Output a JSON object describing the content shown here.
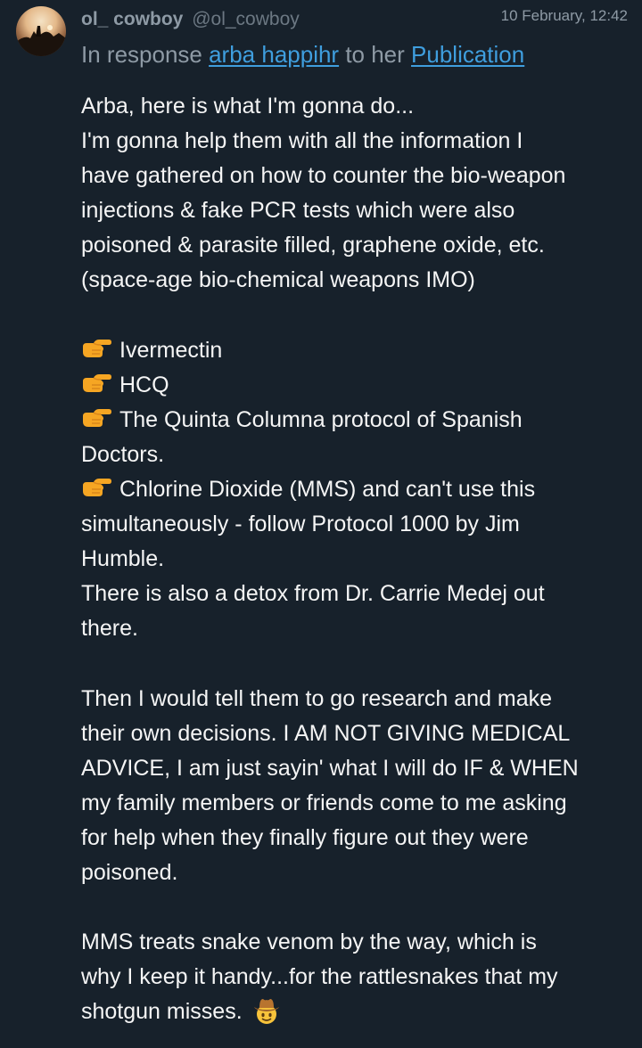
{
  "post": {
    "author_name": "ol_ cowboy",
    "author_handle": "@ol_cowboy",
    "timestamp": "10 February, 12:42",
    "reply": {
      "prefix": "In response ",
      "user_link": "arba happihr",
      "middle": " to her ",
      "publication_link": "Publication"
    },
    "paragraph1": [
      "Arba, here is what I'm gonna do...",
      "I'm gonna help them with all the information I",
      "have gathered on how to counter the bio-weapon",
      "injections & fake PCR tests which were also",
      "poisoned & parasite filled, graphene oxide, etc.",
      "(space-age bio-chemical weapons IMO)"
    ],
    "list": {
      "item1": "Ivermectin",
      "item2": "HCQ",
      "item3_line1": "The Quinta Columna protocol of Spanish",
      "item3_line2": "Doctors.",
      "item4_line1": "Chlorine Dioxide (MMS) and can't use this",
      "item4_line2": "simultaneously - follow Protocol 1000 by Jim",
      "item4_line3": "Humble.",
      "detox_line1": "There is also a detox from Dr. Carrie Medej out",
      "detox_line2": "there."
    },
    "paragraph2": [
      "Then I would tell them to go research and make",
      "their own decisions. I AM NOT GIVING MEDICAL",
      "ADVICE, I am just sayin' what I will do IF & WHEN",
      "my family members or friends come to me asking",
      "for help when they finally figure out they were",
      "poisoned."
    ],
    "paragraph3": {
      "line1": "MMS treats snake venom by the way, which is",
      "line2": "why I keep it handy...for the rattlesnakes that my",
      "line3": "shotgun misses. "
    }
  },
  "icons": {
    "pointing": "backhand-index-pointing-right-emoji",
    "cowboy": "cowboy-hat-face-emoji"
  },
  "colors": {
    "background": "#17212b",
    "text": "#f5f5f5",
    "muted": "#8e9aa5",
    "link": "#3f9ede"
  }
}
